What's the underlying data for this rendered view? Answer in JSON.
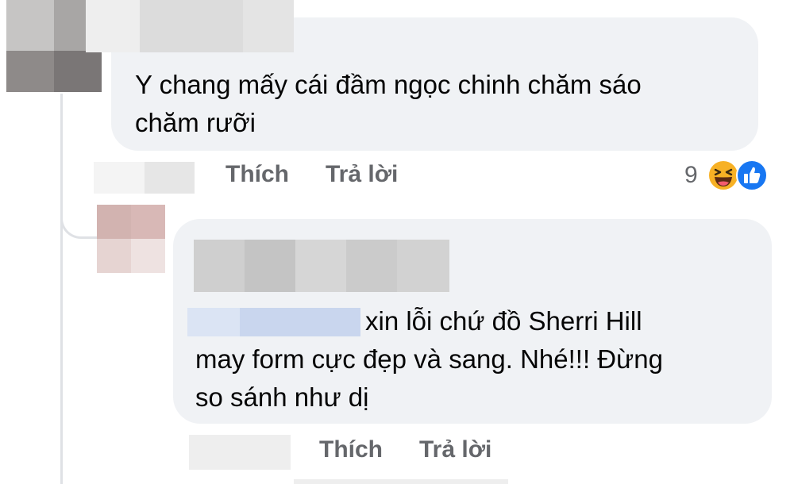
{
  "comment1": {
    "text_line1": "Y chang mấy cái đầm ngọc chinh chăm sáo",
    "text_line2": "chăm rưỡi",
    "actions": {
      "like": "Thích",
      "reply": "Trả lời"
    },
    "reactions": {
      "count": "9",
      "icons": [
        "haha-icon",
        "like-icon"
      ]
    }
  },
  "reply1": {
    "text_line1": "xin lỗi chứ đồ Sherri Hill",
    "text_line2": "may form cực đẹp và sang. Nhé!!! Đừng",
    "text_line3": "so sánh như dị",
    "actions": {
      "like": "Thích",
      "reply": "Trả lời"
    }
  },
  "colors": {
    "bubble": "#f0f2f5",
    "action_text": "#65676b",
    "like_blue": "#1877f2",
    "haha_yellow": "#f7b125",
    "mention_blur": "#c9d6ee"
  }
}
